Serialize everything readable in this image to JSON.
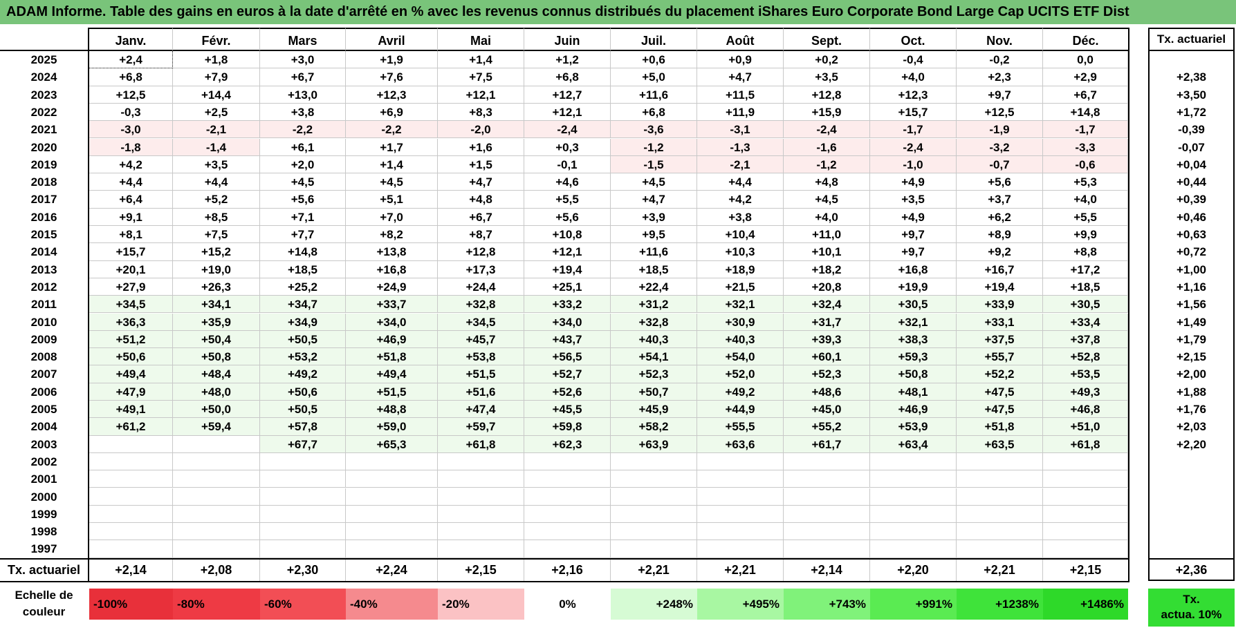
{
  "title": "ADAM Informe. Table des gains en euros à la date d'arrêté en % avec les revenus connus distribués du placement iShares Euro Corporate Bond Large Cap UCITS ETF Dist",
  "months": [
    "Janv.",
    "Févr.",
    "Mars",
    "Avril",
    "Mai",
    "Juin",
    "Juil.",
    "Août",
    "Sept.",
    "Oct.",
    "Nov.",
    "Déc."
  ],
  "tx_header": "Tx. actuariel",
  "rows": [
    {
      "year": "2025",
      "values": [
        "+2,4",
        "+1,8",
        "+3,0",
        "+1,9",
        "+1,4",
        "+1,2",
        "+0,6",
        "+0,9",
        "+0,2",
        "-0,4",
        "-0,2",
        "0,0"
      ],
      "tx": ""
    },
    {
      "year": "2024",
      "values": [
        "+6,8",
        "+7,9",
        "+6,7",
        "+7,6",
        "+7,5",
        "+6,8",
        "+5,0",
        "+4,7",
        "+3,5",
        "+4,0",
        "+2,3",
        "+2,9"
      ],
      "tx": "+2,38"
    },
    {
      "year": "2023",
      "values": [
        "+12,5",
        "+14,4",
        "+13,0",
        "+12,3",
        "+12,1",
        "+12,7",
        "+11,6",
        "+11,5",
        "+12,8",
        "+12,3",
        "+9,7",
        "+6,7"
      ],
      "tx": "+3,50"
    },
    {
      "year": "2022",
      "values": [
        "-0,3",
        "+2,5",
        "+3,8",
        "+6,9",
        "+8,3",
        "+12,1",
        "+6,8",
        "+11,9",
        "+15,9",
        "+15,7",
        "+12,5",
        "+14,8"
      ],
      "tx": "+1,72"
    },
    {
      "year": "2021",
      "values": [
        "-3,0",
        "-2,1",
        "-2,2",
        "-2,2",
        "-2,0",
        "-2,4",
        "-3,6",
        "-3,1",
        "-2,4",
        "-1,7",
        "-1,9",
        "-1,7"
      ],
      "tx": "-0,39"
    },
    {
      "year": "2020",
      "values": [
        "-1,8",
        "-1,4",
        "+6,1",
        "+1,7",
        "+1,6",
        "+0,3",
        "-1,2",
        "-1,3",
        "-1,6",
        "-2,4",
        "-3,2",
        "-3,3"
      ],
      "tx": "-0,07"
    },
    {
      "year": "2019",
      "values": [
        "+4,2",
        "+3,5",
        "+2,0",
        "+1,4",
        "+1,5",
        "-0,1",
        "-1,5",
        "-2,1",
        "-1,2",
        "-1,0",
        "-0,7",
        "-0,6"
      ],
      "tx": "+0,04"
    },
    {
      "year": "2018",
      "values": [
        "+4,4",
        "+4,4",
        "+4,5",
        "+4,5",
        "+4,7",
        "+4,6",
        "+4,5",
        "+4,4",
        "+4,8",
        "+4,9",
        "+5,6",
        "+5,3"
      ],
      "tx": "+0,44"
    },
    {
      "year": "2017",
      "values": [
        "+6,4",
        "+5,2",
        "+5,6",
        "+5,1",
        "+4,8",
        "+5,5",
        "+4,7",
        "+4,2",
        "+4,5",
        "+3,5",
        "+3,7",
        "+4,0"
      ],
      "tx": "+0,39"
    },
    {
      "year": "2016",
      "values": [
        "+9,1",
        "+8,5",
        "+7,1",
        "+7,0",
        "+6,7",
        "+5,6",
        "+3,9",
        "+3,8",
        "+4,0",
        "+4,9",
        "+6,2",
        "+5,5"
      ],
      "tx": "+0,46"
    },
    {
      "year": "2015",
      "values": [
        "+8,1",
        "+7,5",
        "+7,7",
        "+8,2",
        "+8,7",
        "+10,8",
        "+9,5",
        "+10,4",
        "+11,0",
        "+9,7",
        "+8,9",
        "+9,9"
      ],
      "tx": "+0,63"
    },
    {
      "year": "2014",
      "values": [
        "+15,7",
        "+15,2",
        "+14,8",
        "+13,8",
        "+12,8",
        "+12,1",
        "+11,6",
        "+10,3",
        "+10,1",
        "+9,7",
        "+9,2",
        "+8,8"
      ],
      "tx": "+0,72"
    },
    {
      "year": "2013",
      "values": [
        "+20,1",
        "+19,0",
        "+18,5",
        "+16,8",
        "+17,3",
        "+19,4",
        "+18,5",
        "+18,9",
        "+18,2",
        "+16,8",
        "+16,7",
        "+17,2"
      ],
      "tx": "+1,00"
    },
    {
      "year": "2012",
      "values": [
        "+27,9",
        "+26,3",
        "+25,2",
        "+24,9",
        "+24,4",
        "+25,1",
        "+22,4",
        "+21,5",
        "+20,8",
        "+19,9",
        "+19,4",
        "+18,5"
      ],
      "tx": "+1,16"
    },
    {
      "year": "2011",
      "values": [
        "+34,5",
        "+34,1",
        "+34,7",
        "+33,7",
        "+32,8",
        "+33,2",
        "+31,2",
        "+32,1",
        "+32,4",
        "+30,5",
        "+33,9",
        "+30,5"
      ],
      "tx": "+1,56"
    },
    {
      "year": "2010",
      "values": [
        "+36,3",
        "+35,9",
        "+34,9",
        "+34,0",
        "+34,5",
        "+34,0",
        "+32,8",
        "+30,9",
        "+31,7",
        "+32,1",
        "+33,1",
        "+33,4"
      ],
      "tx": "+1,49"
    },
    {
      "year": "2009",
      "values": [
        "+51,2",
        "+50,4",
        "+50,5",
        "+46,9",
        "+45,7",
        "+43,7",
        "+40,3",
        "+40,3",
        "+39,3",
        "+38,3",
        "+37,5",
        "+37,8"
      ],
      "tx": "+1,79"
    },
    {
      "year": "2008",
      "values": [
        "+50,6",
        "+50,8",
        "+53,2",
        "+51,8",
        "+53,8",
        "+56,5",
        "+54,1",
        "+54,0",
        "+60,1",
        "+59,3",
        "+55,7",
        "+52,8"
      ],
      "tx": "+2,15"
    },
    {
      "year": "2007",
      "values": [
        "+49,4",
        "+48,4",
        "+49,2",
        "+49,4",
        "+51,5",
        "+52,7",
        "+52,3",
        "+52,0",
        "+52,3",
        "+50,8",
        "+52,2",
        "+53,5"
      ],
      "tx": "+2,00"
    },
    {
      "year": "2006",
      "values": [
        "+47,9",
        "+48,0",
        "+50,6",
        "+51,5",
        "+51,6",
        "+52,6",
        "+50,7",
        "+49,2",
        "+48,6",
        "+48,1",
        "+47,5",
        "+49,3"
      ],
      "tx": "+1,88"
    },
    {
      "year": "2005",
      "values": [
        "+49,1",
        "+50,0",
        "+50,5",
        "+48,8",
        "+47,4",
        "+45,5",
        "+45,9",
        "+44,9",
        "+45,0",
        "+46,9",
        "+47,5",
        "+46,8"
      ],
      "tx": "+1,76"
    },
    {
      "year": "2004",
      "values": [
        "+61,2",
        "+59,4",
        "+57,8",
        "+59,0",
        "+59,7",
        "+59,8",
        "+58,2",
        "+55,5",
        "+55,2",
        "+53,9",
        "+51,8",
        "+51,0"
      ],
      "tx": "+2,03"
    },
    {
      "year": "2003",
      "values": [
        "",
        "",
        "+67,7",
        "+65,3",
        "+61,8",
        "+62,3",
        "+63,9",
        "+63,6",
        "+61,7",
        "+63,4",
        "+63,5",
        "+61,8"
      ],
      "tx": "+2,20"
    },
    {
      "year": "2002",
      "values": [
        "",
        "",
        "",
        "",
        "",
        "",
        "",
        "",
        "",
        "",
        "",
        ""
      ],
      "tx": ""
    },
    {
      "year": "2001",
      "values": [
        "",
        "",
        "",
        "",
        "",
        "",
        "",
        "",
        "",
        "",
        "",
        ""
      ],
      "tx": ""
    },
    {
      "year": "2000",
      "values": [
        "",
        "",
        "",
        "",
        "",
        "",
        "",
        "",
        "",
        "",
        "",
        ""
      ],
      "tx": ""
    },
    {
      "year": "1999",
      "values": [
        "",
        "",
        "",
        "",
        "",
        "",
        "",
        "",
        "",
        "",
        "",
        ""
      ],
      "tx": ""
    },
    {
      "year": "1998",
      "values": [
        "",
        "",
        "",
        "",
        "",
        "",
        "",
        "",
        "",
        "",
        "",
        ""
      ],
      "tx": ""
    },
    {
      "year": "1997",
      "values": [
        "",
        "",
        "",
        "",
        "",
        "",
        "",
        "",
        "",
        "",
        "",
        ""
      ],
      "tx": ""
    }
  ],
  "footer": {
    "label": "Tx. actuariel",
    "values": [
      "+2,14",
      "+2,08",
      "+2,30",
      "+2,24",
      "+2,15",
      "+2,16",
      "+2,21",
      "+2,21",
      "+2,14",
      "+2,20",
      "+2,21",
      "+2,15"
    ],
    "tx": "+2,36"
  },
  "scale": {
    "label_line1": "Echelle de",
    "label_line2": "couleur",
    "items": [
      {
        "label": "-100%",
        "color": "#e8303a",
        "kind": "neg"
      },
      {
        "label": "-80%",
        "color": "#ee3a44",
        "kind": "neg"
      },
      {
        "label": "-60%",
        "color": "#f24e55",
        "kind": "neg"
      },
      {
        "label": "-40%",
        "color": "#f58a8e",
        "kind": "neg"
      },
      {
        "label": "-20%",
        "color": "#fbc2c4",
        "kind": "neg"
      },
      {
        "label": "0%",
        "color": "#ffffff",
        "kind": "zero"
      },
      {
        "label": "+248%",
        "color": "#d6fbd4",
        "kind": "pos"
      },
      {
        "label": "+495%",
        "color": "#a8f7a2",
        "kind": "pos"
      },
      {
        "label": "+743%",
        "color": "#80f27a",
        "kind": "pos"
      },
      {
        "label": "+991%",
        "color": "#5aeb52",
        "kind": "pos"
      },
      {
        "label": "+1238%",
        "color": "#3fe33a",
        "kind": "pos"
      },
      {
        "label": "+1486%",
        "color": "#2ed929",
        "kind": "pos"
      }
    ],
    "tx_line1": "Tx.",
    "tx_line2": "actua. 10%",
    "tx_color": "#33dd33"
  },
  "colors": {
    "title_bg": "#79c47a",
    "neg_tint": "#fdecec",
    "pos_tint": "#eefaec"
  }
}
